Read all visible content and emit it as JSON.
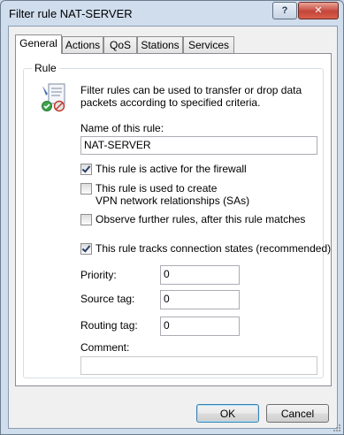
{
  "window": {
    "title": "Filter rule NAT-SERVER",
    "help_label": "?",
    "close_label": "✕"
  },
  "tabs": [
    {
      "label": "General",
      "active": true
    },
    {
      "label": "Actions",
      "active": false
    },
    {
      "label": "QoS",
      "active": false
    },
    {
      "label": "Stations",
      "active": false
    },
    {
      "label": "Services",
      "active": false
    }
  ],
  "rule_group": {
    "label": "Rule",
    "description": "Filter rules can be used to transfer or drop data packets according to specified criteria.",
    "name_label": "Name of this rule:",
    "name_value": "NAT-SERVER",
    "checkboxes": [
      {
        "label": "This rule is active for the firewall",
        "checked": true
      },
      {
        "label_line1": "This rule is used to create",
        "label_line2": "VPN network relationships (SAs)",
        "checked": false
      },
      {
        "label": "Observe further rules, after this rule matches",
        "checked": false
      },
      {
        "label": "This rule tracks connection states (recommended)",
        "checked": true
      }
    ],
    "priority_label": "Priority:",
    "priority_value": "0",
    "source_tag_label": "Source tag:",
    "source_tag_value": "0",
    "routing_tag_label": "Routing tag:",
    "routing_tag_value": "0",
    "comment_label": "Comment:",
    "comment_value": ""
  },
  "buttons": {
    "ok": "OK",
    "cancel": "Cancel"
  },
  "colors": {
    "title_bar": "#cfdded",
    "close_button": "#c4453a",
    "default_button_border": "#3c7fb1"
  }
}
